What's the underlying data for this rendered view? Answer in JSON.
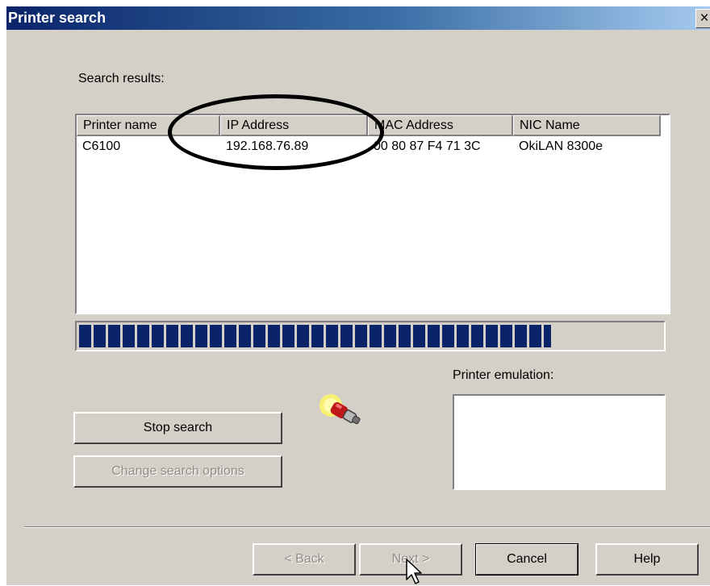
{
  "window": {
    "title": "Printer search",
    "close_glyph": "×"
  },
  "search_results_label": "Search results:",
  "results_table": {
    "columns": [
      "Printer name",
      "IP Address",
      "MAC Address",
      "NIC Name"
    ],
    "rows": [
      [
        "C6100",
        "192.168.76.89",
        "00 80 87 F4 71 3C",
        "OkiLAN 8300e"
      ]
    ]
  },
  "progress": {
    "fraction": 0.81,
    "bar_color": "#0a246a"
  },
  "buttons": {
    "stop_search": "Stop search",
    "change_search_options": "Change search options",
    "back": "< Back",
    "next": "Next >",
    "cancel": "Cancel",
    "help": "Help"
  },
  "printer_emulation_label": "Printer emulation:",
  "icons": {
    "animation": "searching-plug-icon",
    "cursor": "mouse-pointer-icon"
  }
}
